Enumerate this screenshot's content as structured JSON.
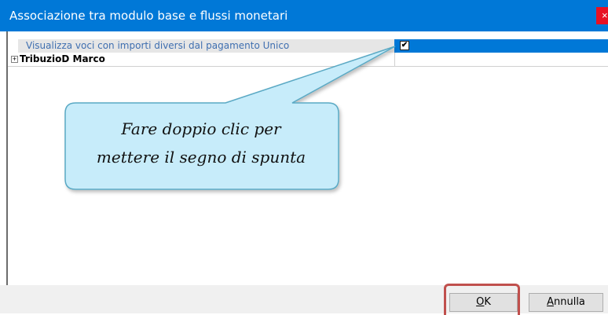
{
  "window": {
    "title": "Associazione tra modulo base e flussi monetari",
    "close_glyph": "×"
  },
  "grid": {
    "rows": [
      {
        "label": "Visualizza voci con importi diversi dal pagamento Unico",
        "checked": true,
        "check_glyph": "✔"
      },
      {
        "label": "TribuzioD Marco",
        "expander_glyph": "+"
      }
    ]
  },
  "callout": {
    "line1": "Fare doppio clic per",
    "line2": "mettere il segno di spunta",
    "fill_color": "#c7ecfa",
    "border_color": "#5aa9c4"
  },
  "buttons": {
    "ok_mnemonic": "O",
    "ok_rest": "K",
    "cancel_mnemonic": "A",
    "cancel_rest": "nnulla"
  },
  "colors": {
    "title_bar": "#0078d7",
    "close_button": "#e81123",
    "highlight_frame": "#c0504d"
  }
}
